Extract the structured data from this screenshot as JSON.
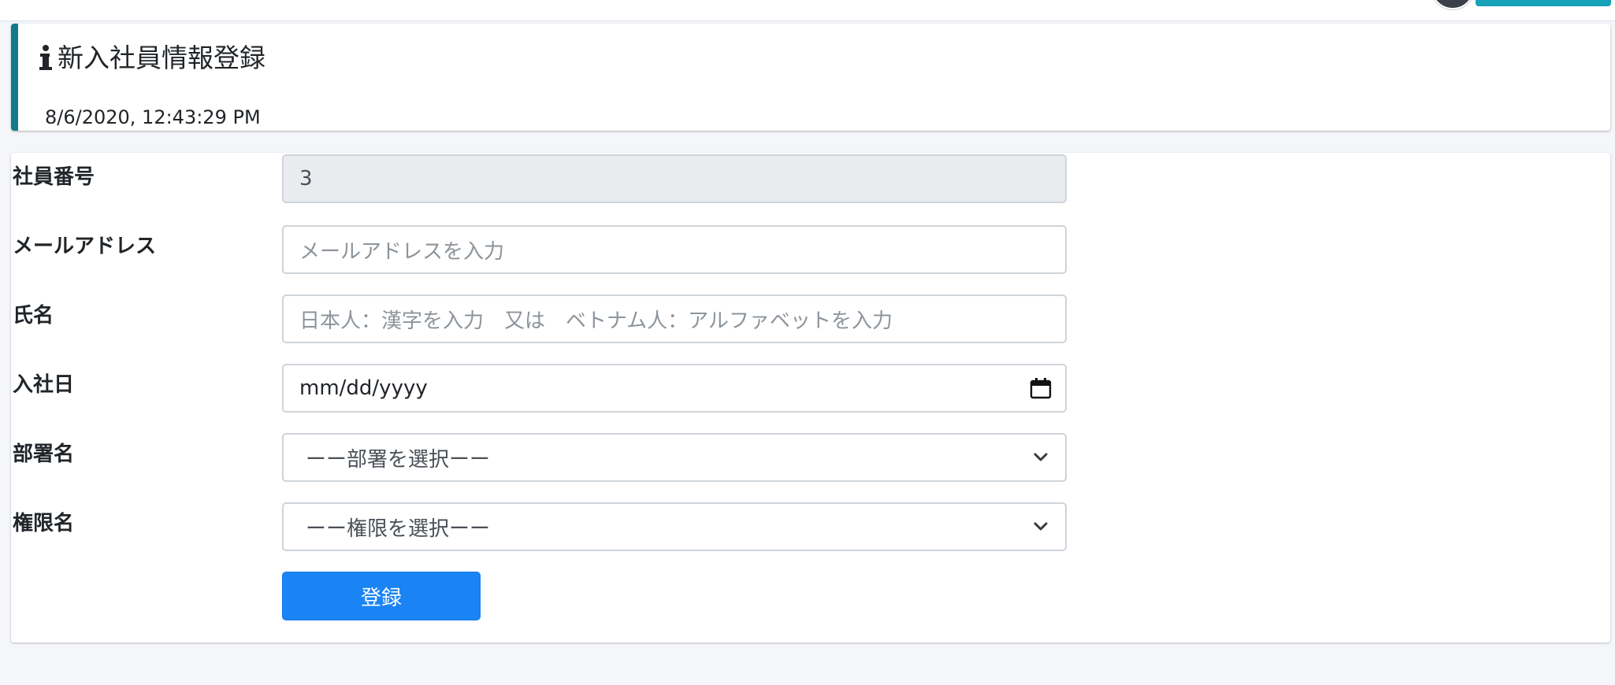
{
  "header": {
    "title": "新入社員情報登録",
    "timestamp": "8/6/2020, 12:43:29 PM",
    "icon": "info-icon"
  },
  "form": {
    "employee_number": {
      "label": "社員番号",
      "value": "3"
    },
    "email": {
      "label": "メールアドレス",
      "placeholder": "メールアドレスを入力"
    },
    "full_name": {
      "label": "氏名",
      "placeholder": "日本人：漢字を入力　又は　ベトナム人：アルファベットを入力"
    },
    "hire_date": {
      "label": "入社日",
      "value": "mm/dd/yyyy",
      "icon": "calendar-icon"
    },
    "department": {
      "label": "部署名",
      "selected": "ーー部署を選択ーー",
      "icon": "chevron-down-icon"
    },
    "role": {
      "label": "権限名",
      "selected": "ーー権限を選択ーー",
      "icon": "chevron-down-icon"
    },
    "submit_label": "登録"
  },
  "colors": {
    "accent": "#1b84f5",
    "callout_border": "#117a8b",
    "top_button": "#17a2b8"
  }
}
